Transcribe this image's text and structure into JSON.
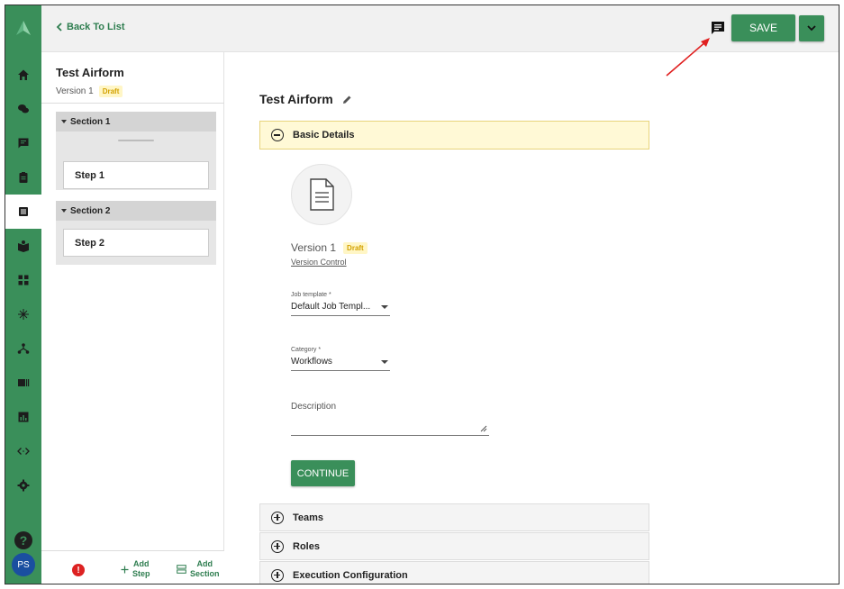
{
  "header": {
    "back_label": "Back To List",
    "save_label": "SAVE"
  },
  "nav": {
    "items": [
      "home",
      "chat",
      "message",
      "clipboard",
      "form-builder",
      "book",
      "dashboard",
      "network",
      "hierarchy",
      "media",
      "reports",
      "code",
      "settings"
    ],
    "active": "form-builder",
    "user_initials": "PS"
  },
  "outline": {
    "form_name": "Test Airform",
    "version_label": "Version 1",
    "status": "Draft",
    "sections": [
      {
        "name": "Section 1",
        "steps": [
          "Step 1"
        ]
      },
      {
        "name": "Section 2",
        "steps": [
          "Step 2"
        ]
      }
    ],
    "footer": {
      "add_step_line1": "Add",
      "add_step_line2": "Step",
      "add_section_line1": "Add",
      "add_section_line2": "Section"
    }
  },
  "main": {
    "title": "Test Airform",
    "basic_details_label": "Basic Details",
    "version_label": "Version 1",
    "status": "Draft",
    "version_control_link": "Version Control",
    "job_template": {
      "label": "Job template *",
      "value": "Default Job Templ..."
    },
    "category": {
      "label": "Category *",
      "value": "Workflows"
    },
    "description": {
      "label": "Description",
      "value": ""
    },
    "continue_label": "CONTINUE",
    "accordions": [
      "Teams",
      "Roles",
      "Execution Configuration"
    ]
  },
  "colors": {
    "brand_green": "#3a8f5a",
    "draft_badge": "#d3a100",
    "active_accordion_bg": "#fff9d6",
    "annotation_arrow": "#e02020"
  }
}
